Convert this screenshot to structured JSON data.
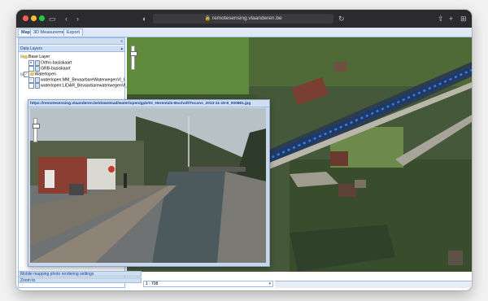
{
  "browser": {
    "url": "remotesensing.vlaanderen.be",
    "icons": [
      "sidebar-icon",
      "back-icon",
      "forward-icon",
      "shield-icon",
      "lock-icon",
      "reload-icon",
      "share-icon",
      "new-tab-icon",
      "tabs-overview-icon"
    ]
  },
  "tabs": [
    {
      "label": "Map",
      "active": true
    },
    {
      "label": "3D Measurements",
      "active": false
    },
    {
      "label": "Export",
      "active": false
    }
  ],
  "sidebar": {
    "data_layers_title": "Data Layers",
    "tree": [
      {
        "label": "Base Layer",
        "level": 0,
        "type": "folder",
        "checked": null
      },
      {
        "label": "Ortho-basiskaart",
        "level": 1,
        "type": "layer",
        "checked": true
      },
      {
        "label": "GRB-basiskaart",
        "level": 1,
        "type": "layer",
        "checked": false
      },
      {
        "label": "Waterlopen",
        "level": 0,
        "type": "folder",
        "checked": true
      },
      {
        "label": "waterlopen:MM_BevaarbareWaterwegenVl_I",
        "level": 1,
        "type": "layer",
        "checked": true
      },
      {
        "label": "waterlopen:LIDAR_BevaarbarewaterwegenVl_I",
        "level": 1,
        "type": "layer",
        "checked": false
      }
    ],
    "mobile_mapping_settings": "Mobile mapping photo rendering settings",
    "zoom_to": "Zoom to"
  },
  "photo_window": {
    "title": "https://remotesensing.vlaanderen.be/download/waterlopen/gpb/02_Herentals-Bocholt/Tocons_2013-11-19-8_000881.jpg"
  },
  "scale": {
    "value": "1 : 708"
  },
  "colors": {
    "panel_header": "#d0def0",
    "panel_border": "#99bbe8",
    "panel_text": "#15428b",
    "titlebar": "#2b2b2e"
  }
}
